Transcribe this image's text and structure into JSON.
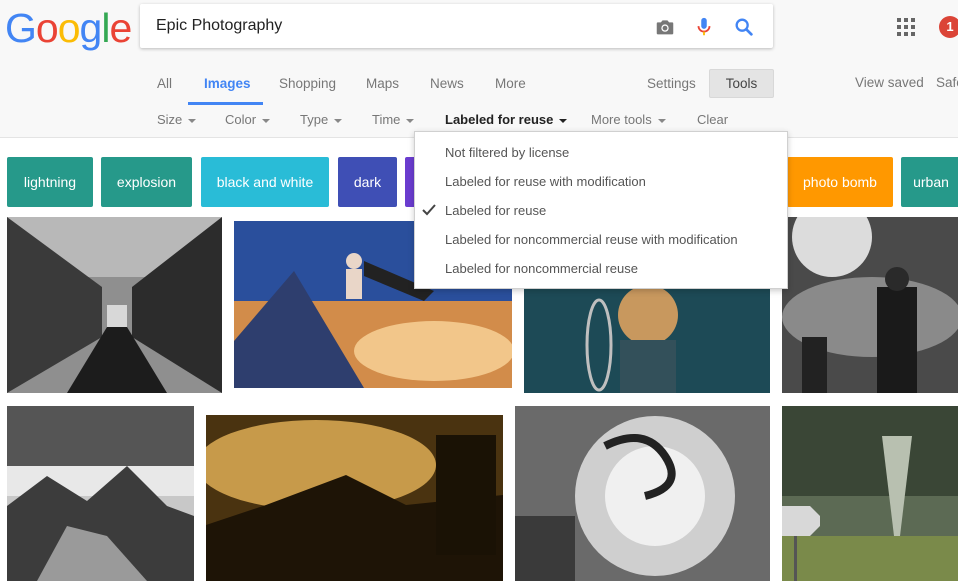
{
  "logo": [
    "G",
    "o",
    "o",
    "g",
    "l",
    "e"
  ],
  "search": {
    "value": "Epic Photography"
  },
  "notifications": {
    "count": "1"
  },
  "tabs": [
    "All",
    "Images",
    "Shopping",
    "Maps",
    "News",
    "More"
  ],
  "right_links": {
    "settings": "Settings",
    "tools": "Tools",
    "view_saved": "View saved",
    "safe": "Safe"
  },
  "tools_row": {
    "size": "Size",
    "color": "Color",
    "type": "Type",
    "time": "Time",
    "license": "Labeled for reuse",
    "more_tools": "More tools",
    "clear": "Clear"
  },
  "chips": [
    {
      "label": "lightning",
      "color": "#26998a"
    },
    {
      "label": "explosion",
      "color": "#26998a"
    },
    {
      "label": "black and white",
      "color": "#29bcd7"
    },
    {
      "label": "dark",
      "color": "#3f4fb5"
    },
    {
      "label": "photo bomb",
      "color": "#ff9800"
    },
    {
      "label": "urban",
      "color": "#26998a"
    }
  ],
  "license_menu": {
    "items": [
      "Not filtered by license",
      "Labeled for reuse with modification",
      "Labeled for reuse",
      "Labeled for noncommercial reuse with modification",
      "Labeled for noncommercial reuse"
    ],
    "selected": "Labeled for reuse"
  },
  "icons": {
    "camera": "camera-icon",
    "mic": "microphone-icon",
    "search": "search-icon",
    "apps": "apps-grid-icon",
    "check": "check-icon"
  },
  "colors": {
    "google_blue": "#4285f4",
    "google_red": "#ea4335",
    "google_yellow": "#fbbc05",
    "google_green": "#34a853",
    "badge_red": "#db4437"
  }
}
